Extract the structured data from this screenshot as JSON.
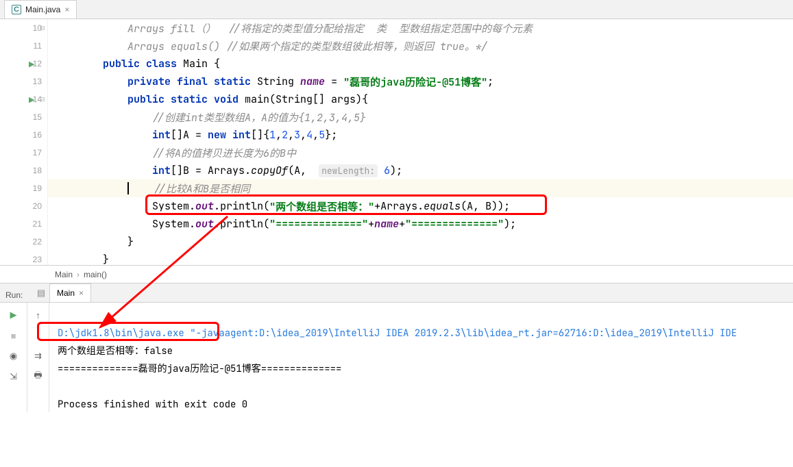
{
  "tab": {
    "filename": "Main.java",
    "close": "×"
  },
  "gutter": {
    "start": 10,
    "lines": [
      10,
      11,
      12,
      13,
      14,
      15,
      16,
      17,
      18,
      19,
      20,
      21,
      22,
      23
    ],
    "play_lines": [
      12,
      14
    ],
    "fold_lines": [
      10,
      14
    ]
  },
  "code": {
    "l10": {
      "indent": "            ",
      "cmt": "Arrays fill（）  //将指定的类型值分配给指定  类  型数组指定范围中的每个元素"
    },
    "l11": {
      "indent": "            ",
      "cmt": "Arrays equals() //如果两个指定的类型数组彼此相等，则返回 true。*/"
    },
    "l12": {
      "indent": "        ",
      "kw1": "public class ",
      "cls": "Main",
      "brace": " {"
    },
    "l13": {
      "indent": "            ",
      "kw": "private final static ",
      "type": "String ",
      "var": "name",
      "eq": " = ",
      "str": "\"磊哥的java历险记-@51博客\"",
      "semi": ";"
    },
    "l14": {
      "indent": "            ",
      "kw": "public static void ",
      "mname": "main",
      "args": "(String[] args){"
    },
    "l15": {
      "indent": "                ",
      "cmt": "//创建int类型数组A，A的值为{1,2,3,4,5}"
    },
    "l16": {
      "indent": "                ",
      "kw": "int",
      "arr": "[]A = ",
      "kw2": "new int",
      "rest": "[]{",
      "n1": "1",
      "c": ",",
      "n2": "2",
      "n3": "3",
      "n4": "4",
      "n5": "5",
      "end": "};"
    },
    "l17": {
      "indent": "                ",
      "cmt": "//将A的值拷贝进长度为6的B中"
    },
    "l18": {
      "indent": "                ",
      "kw": "int",
      "arr": "[]B = Arrays.",
      "mth": "copyOf",
      "open": "(A,  ",
      "hint": "newLength:",
      "sp": " ",
      "n": "6",
      "end": ");"
    },
    "l19": {
      "indent": "                ",
      "cmt": "//比较A和B是否相同"
    },
    "l20": {
      "indent": "                ",
      "pre": "System.",
      "out": "out",
      "dot": ".",
      "mth": "println",
      "open": "(",
      "str": "\"两个数组是否相等：\"",
      "plus": "+Arrays.",
      "mth2": "equals",
      "args": "(A, B));"
    },
    "l21": {
      "indent": "                ",
      "pre": "System.",
      "out": "out",
      "dot": ".",
      "mth": "println",
      "open": "(",
      "str": "\"==============\"",
      "plus": "+",
      "name": "name",
      "plus2": "+",
      "str2": "\"==============\"",
      "end": ");"
    },
    "l22": {
      "indent": "            ",
      "brace": "}"
    },
    "l23": {
      "indent": "        ",
      "brace": "}"
    }
  },
  "breadcrumb": {
    "item1": "Main",
    "sep": "›",
    "item2": "main()"
  },
  "run": {
    "label": "Run:",
    "tab": "Main",
    "close": "×",
    "cmd": "D:\\jdk1.8\\bin\\java.exe \"-javaagent:D:\\idea_2019\\IntelliJ IDEA 2019.2.3\\lib\\idea_rt.jar=62716:D:\\idea_2019\\IntelliJ IDE",
    "out1": "两个数组是否相等：false",
    "out2": "==============磊哥的java历险记-@51博客==============",
    "blank": "",
    "exit": "Process finished with exit code 0"
  }
}
